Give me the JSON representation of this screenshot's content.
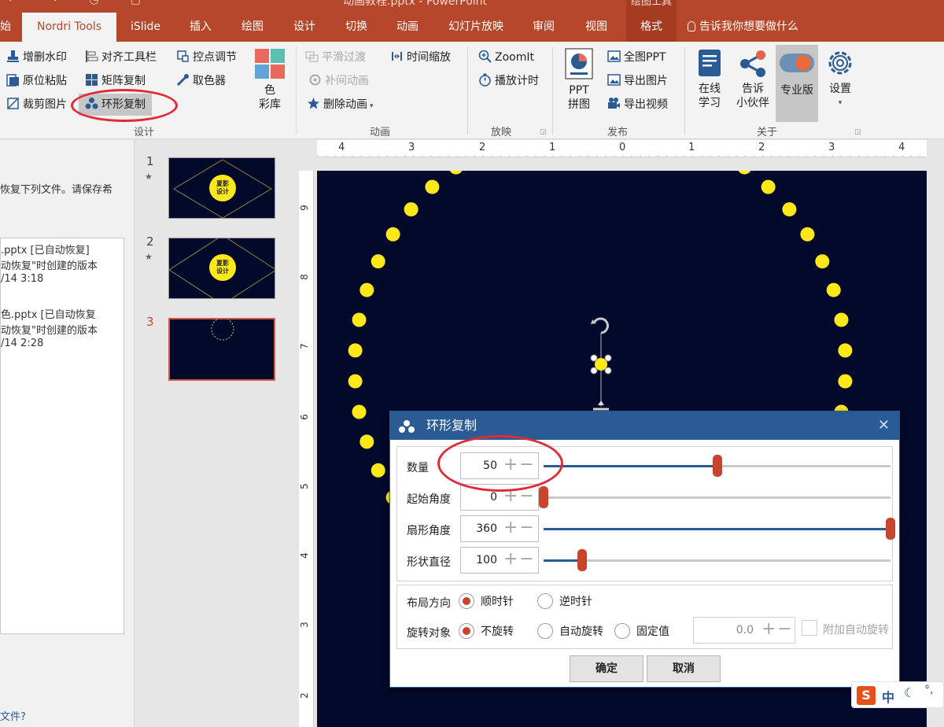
{
  "titlebar": {
    "doc_title": "动画教程.pptx - PowerPoint",
    "context_title": "绘图工具"
  },
  "tabs": [
    {
      "label": "始"
    },
    {
      "label": "Nordri Tools"
    },
    {
      "label": "iSlide"
    },
    {
      "label": "插入"
    },
    {
      "label": "绘图"
    },
    {
      "label": "设计"
    },
    {
      "label": "切换"
    },
    {
      "label": "动画"
    },
    {
      "label": "幻灯片放映"
    },
    {
      "label": "审阅"
    },
    {
      "label": "视图"
    },
    {
      "label": "格式"
    }
  ],
  "tell_me": "告诉我你想要做什么",
  "ribbon": {
    "design": {
      "label": "设计",
      "watermark": "增删水印",
      "align_toolbar": "对齐工具栏",
      "control_points": "控点调节",
      "paste_in_place": "原位粘贴",
      "matrix_copy": "矩阵复制",
      "color_picker": "取色器",
      "crop_image": "裁剪图片",
      "ring_copy": "环形复制",
      "color_library_1": "色",
      "color_library_2": "彩库"
    },
    "animation": {
      "label": "动画",
      "smooth_transition": "平滑过渡",
      "time_scale": "时间缩放",
      "tween_animation": "补间动画",
      "delete_animation": "删除动画"
    },
    "playback": {
      "label": "放映",
      "zoomit": "ZoomIt",
      "play_timer": "播放计时"
    },
    "publish": {
      "label": "发布",
      "ppt_collage_1": "PPT",
      "ppt_collage_2": "拼图",
      "full_ppt": "全图PPT",
      "export_image": "导出图片",
      "export_video": "导出视频"
    },
    "about": {
      "label": "关于",
      "online_learning_1": "在线",
      "online_learning_2": "学习",
      "tell_friends_1": "告诉",
      "tell_friends_2": "小伙伴",
      "pro_version": "专业版",
      "settings": "设置"
    }
  },
  "left_pane": {
    "recover_text": "恢复下列文件。请保存希",
    "items": [
      {
        "name": ".pptx  [已自动恢复]",
        "desc": "动恢复\"时创建的版本",
        "time": "/14 3:18"
      },
      {
        "name": "色.pptx  [已自动恢复",
        "desc": "动恢复\"时创建的版本",
        "time": "/14 2:28"
      }
    ],
    "link": "文件?"
  },
  "thumbnails": [
    {
      "number": "1",
      "star": "★",
      "logo_line1": "夏影",
      "logo_line2": "设计"
    },
    {
      "number": "2",
      "star": "★",
      "logo_line1": "夏影",
      "logo_line2": "设计"
    },
    {
      "number": "3"
    }
  ],
  "rulers": {
    "horizontal": [
      "4",
      "3",
      "2",
      "1",
      "0",
      "1",
      "2",
      "3",
      "4"
    ],
    "vertical": [
      "9",
      "8",
      "7",
      "6",
      "5",
      "4",
      "3",
      "2"
    ]
  },
  "dialog": {
    "title": "环形复制",
    "close": "✕",
    "params": [
      {
        "label": "数量",
        "value": "50",
        "fraction": 0.5
      },
      {
        "label": "起始角度",
        "value": "0",
        "fraction": 0.0
      },
      {
        "label": "扇形角度",
        "value": "360",
        "fraction": 1.0
      },
      {
        "label": "形状直径",
        "value": "100",
        "fraction": 0.11
      }
    ],
    "pm_symbol": "+−",
    "layout_direction": {
      "label": "布局方向",
      "clockwise": "顺时针",
      "counterclockwise": "逆时针"
    },
    "rotation": {
      "label": "旋转对象",
      "no_rotation": "不旋转",
      "auto_rotation": "自动旋转",
      "fixed_value": "固定值",
      "fixed_input": "0.0",
      "attach_auto_rotation": "附加自动旋转"
    },
    "ok": "确定",
    "cancel": "取消"
  },
  "ime": {
    "logo": "S",
    "lang": "中"
  },
  "colors": {
    "accent": "#b7472a",
    "dialog_blue": "#2a5b95",
    "slider_thumb": "#c8442c",
    "slide_bg": "#02092a",
    "dot": "#ffe81a",
    "annotation": "#e02a36"
  }
}
